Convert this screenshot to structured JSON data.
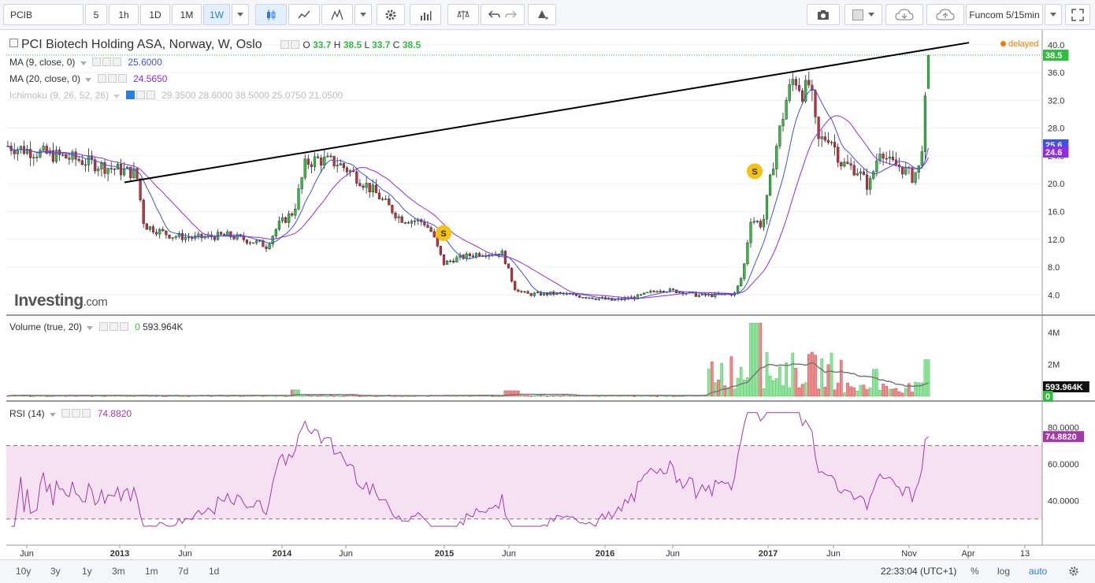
{
  "toolbar": {
    "symbol": "PCIB",
    "intervals": [
      "5",
      "1h",
      "1D",
      "1M",
      "1W"
    ],
    "active_interval": "1W",
    "right_dropdown": "Funcom 5/15min"
  },
  "legend": {
    "title": "PCI Biotech Holding ASA, Norway, W, Oslo",
    "o_label": "O",
    "o_value": "33.7",
    "h_label": "H",
    "h_value": "38.5",
    "l_label": "L",
    "l_value": "33.7",
    "c_label": "C",
    "c_value": "38.5",
    "ma9_label": "MA (9, close, 0)",
    "ma9_value": "25.6000",
    "ma20_label": "MA (20, close, 0)",
    "ma20_value": "24.5650",
    "ichimoku_label": "Ichimoku (9, 26, 52, 26)",
    "ichimoku_values": "29.3500 28.6000 38.5000 25.0750 21.0500",
    "delayed": "delayed",
    "watermark": "Investing",
    "watermark_suffix": ".com"
  },
  "volume_legend": {
    "label": "Volume (true, 20)",
    "value": "593.964K"
  },
  "rsi_legend": {
    "label": "RSI (14)",
    "value": "74.8820"
  },
  "price_axis": {
    "ticks": [
      "40.0",
      "36.0",
      "32.0",
      "28.0",
      "24.0",
      "20.0",
      "16.0",
      "12.0",
      "8.0",
      "4.0"
    ],
    "last_label": "38.5",
    "ma9_label": "25.6",
    "ma20_label": "24.6"
  },
  "volume_axis": {
    "ticks": [
      "4M",
      "2M"
    ],
    "last_label": "593.964K",
    "zero_label": "0"
  },
  "rsi_axis": {
    "ticks": [
      "80.0000",
      "60.0000",
      "40.0000"
    ],
    "last_label": "74.8820"
  },
  "time_axis": [
    "Jun",
    "2013",
    "Jun",
    "2014",
    "Jun",
    "2015",
    "Jun",
    "2016",
    "Jun",
    "2017",
    "Jun",
    "Nov",
    "Apr",
    "13"
  ],
  "markers": [
    "S",
    "S"
  ],
  "bottombar": {
    "ranges": [
      "10y",
      "3y",
      "1y",
      "3m",
      "1m",
      "7d",
      "1d"
    ],
    "time": "22:33:04 (UTC+1)",
    "percent": "%",
    "log": "log",
    "auto": "auto"
  },
  "colors": {
    "up": "#2ebd3f",
    "down": "#c4303a",
    "ma9": "#3f51e0",
    "ma20": "#8e2de2",
    "rsi": "#a13aa8",
    "rsi_band": "#f4dcf2",
    "trendline": "#000000"
  },
  "chart_data": {
    "type": "candlestick",
    "series": [
      {
        "name": "PCI Biotech Holding ASA",
        "close_last": 38.5,
        "open_last": 33.7,
        "high_last": 38.5,
        "low_last": 33.7
      },
      {
        "name": "MA (9, close, 0)",
        "last": 25.6
      },
      {
        "name": "MA (20, close, 0)",
        "last": 24.565
      },
      {
        "name": "Volume (true, 20)",
        "last": 593964
      },
      {
        "name": "RSI (14)",
        "last": 74.882
      }
    ],
    "price_ylim": [
      2,
      41
    ],
    "volume_ylim": [
      0,
      4900000
    ],
    "rsi_ylim": [
      20,
      90
    ],
    "rsi_band": [
      30,
      70
    ]
  }
}
